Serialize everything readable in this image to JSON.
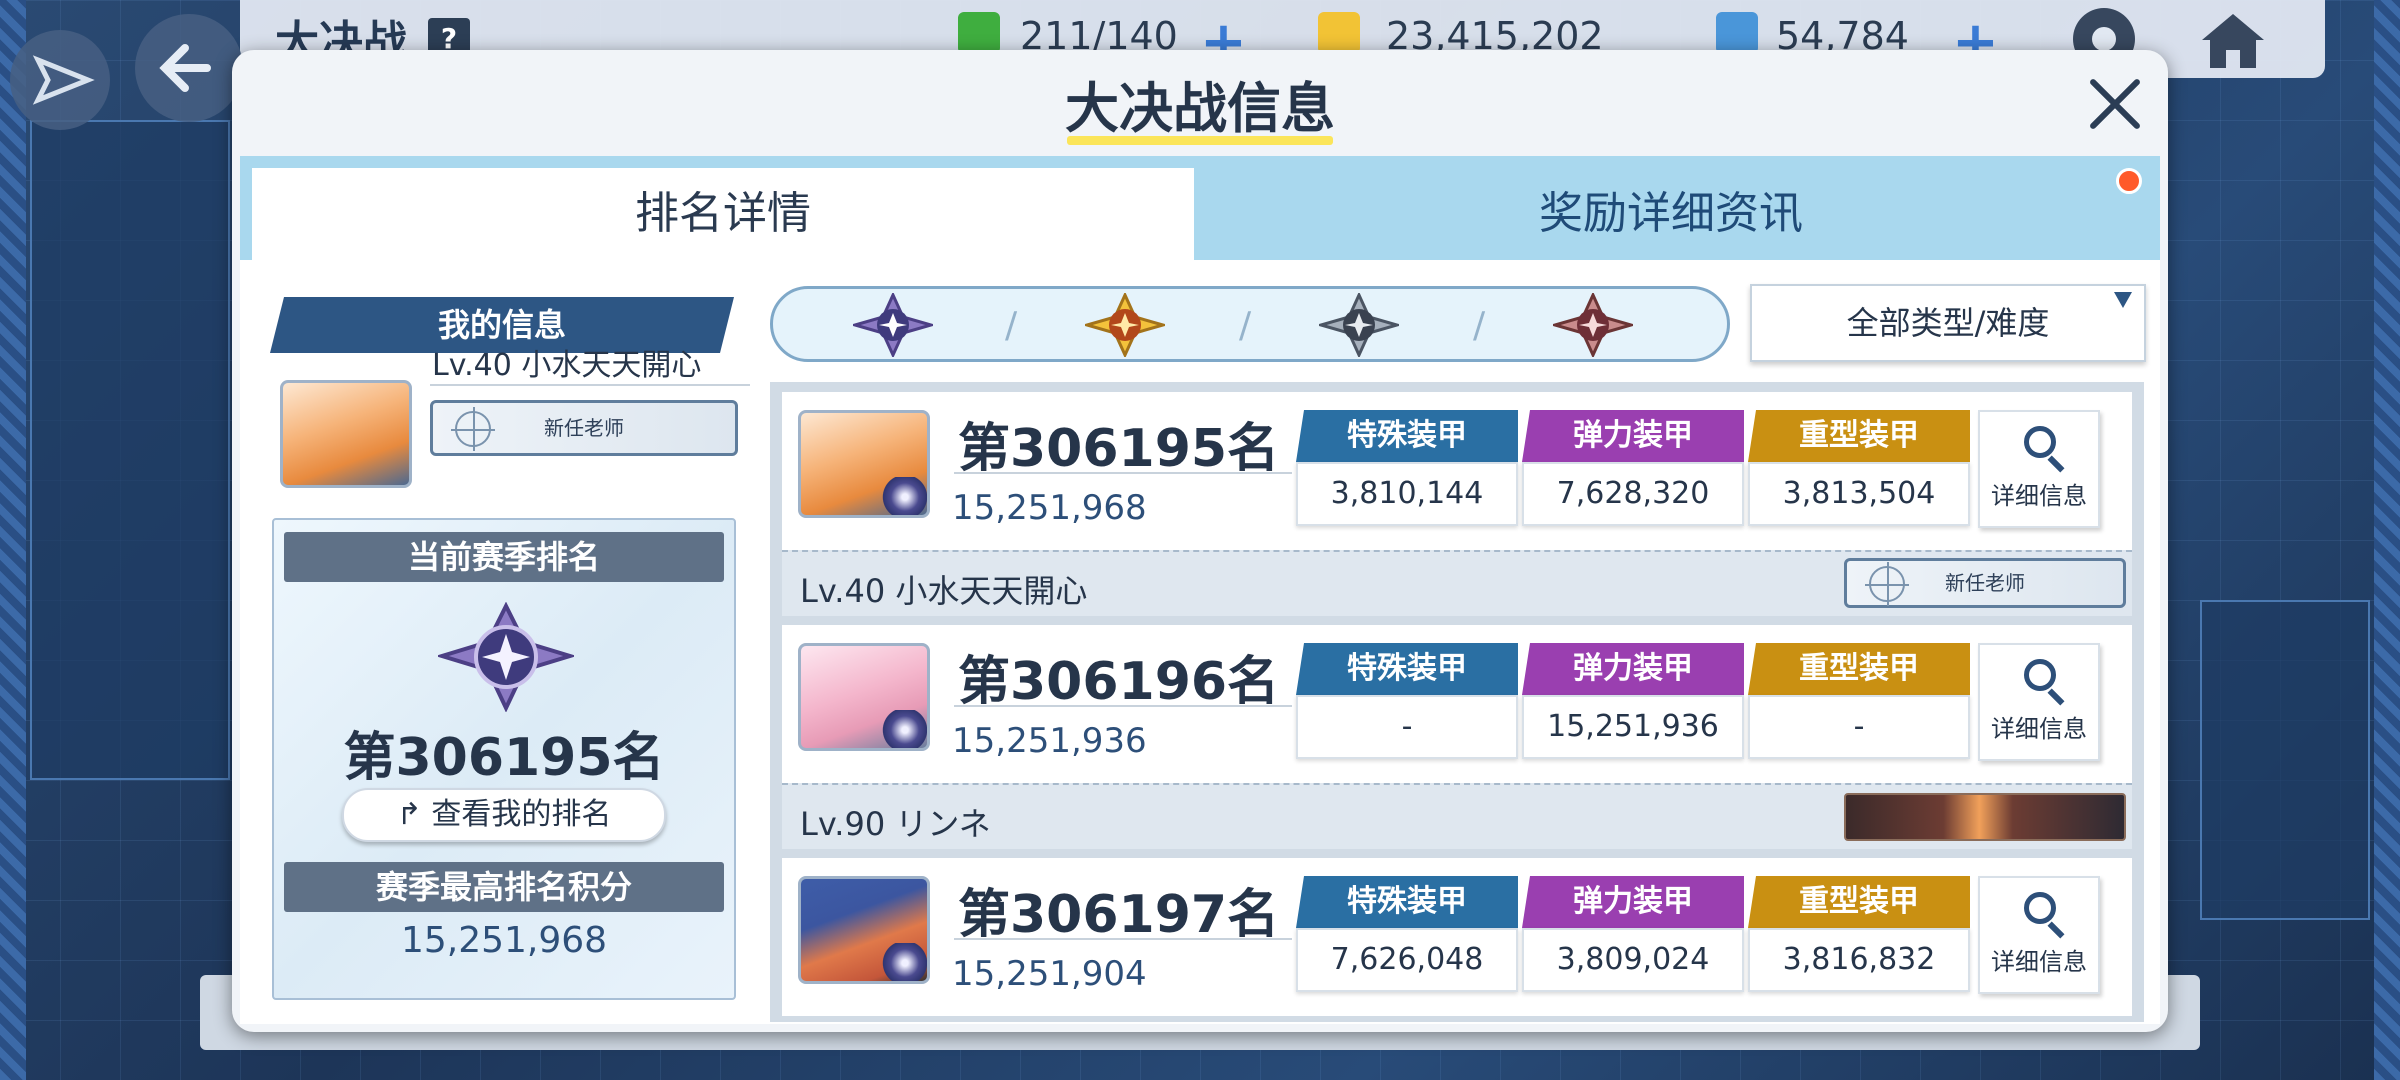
{
  "topbar": {
    "title": "大决战",
    "help": "?",
    "ap": "211/140",
    "credits": "23,415,202",
    "gems": "54,784"
  },
  "modal": {
    "title": "大决战信息",
    "tabs": [
      {
        "label": "排名详情",
        "active": true
      },
      {
        "label": "奖励详细资讯",
        "active": false
      }
    ]
  },
  "my_info": {
    "header": "我的信息",
    "name": "Lv.40 小水天天開心",
    "title_plate": "新任老师",
    "season_rank_header": "当前赛季排名",
    "rank": "第306195名",
    "view_button": "查看我的排名",
    "best_score_header": "赛季最高排名积分",
    "best_score": "15,251,968"
  },
  "filter": {
    "difficulty_icons": [
      "insane-tier-icon",
      "extreme-tier-icon",
      "hardcore-tier-icon",
      "veryhard-tier-icon"
    ],
    "type_select": "全部类型/难度"
  },
  "entries": [
    {
      "rank": "第306195名",
      "score": "15,251,968",
      "special_label": "特殊装甲",
      "special": "3,810,144",
      "elastic_label": "弹力装甲",
      "elastic": "7,628,320",
      "heavy_label": "重型装甲",
      "heavy": "3,813,504",
      "detail": "详细信息",
      "player": "Lv.40  小水天天開心",
      "plate": "新任老师"
    },
    {
      "rank": "第306196名",
      "score": "15,251,936",
      "special_label": "特殊装甲",
      "special": "-",
      "elastic_label": "弹力装甲",
      "elastic": "15,251,936",
      "heavy_label": "重型装甲",
      "heavy": "-",
      "detail": "详细信息",
      "player": "Lv.90  リンネ",
      "plate": ""
    },
    {
      "rank": "第306197名",
      "score": "15,251,904",
      "special_label": "特殊装甲",
      "special": "7,626,048",
      "elastic_label": "弹力装甲",
      "elastic": "3,809,024",
      "heavy_label": "重型装甲",
      "heavy": "3,816,832",
      "detail": "详细信息",
      "player": "",
      "plate": ""
    }
  ],
  "colors": {
    "special": "#2a6fa3",
    "elastic": "#9a3fb0",
    "heavy": "#c99012",
    "accent_underline": "#fbe55a",
    "header_blue": "#2d5684"
  }
}
